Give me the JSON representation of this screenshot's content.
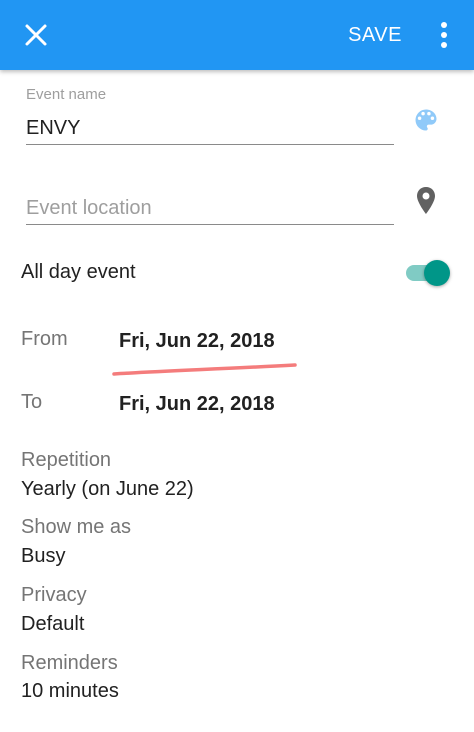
{
  "appbar": {
    "save_label": "SAVE",
    "color": "#2196F3",
    "icons": [
      "close-icon",
      "more-vert-icon"
    ]
  },
  "event": {
    "name_label": "Event name",
    "name_value": "ENVY",
    "location_placeholder": "Event location",
    "location_value": "",
    "icons": [
      "palette-icon",
      "location-pin-icon"
    ]
  },
  "all_day": {
    "label": "All day event",
    "on": true,
    "color": "#009688"
  },
  "from": {
    "label": "From",
    "value": "Fri, Jun 22, 2018"
  },
  "to": {
    "label": "To",
    "value": "Fri, Jun 22, 2018"
  },
  "annotation": {
    "type": "hand-drawn underline",
    "color": "#F47C7C"
  },
  "details": {
    "repetition": {
      "label": "Repetition",
      "value": "Yearly (on June 22)"
    },
    "show_as": {
      "label": "Show me as",
      "value": "Busy"
    },
    "privacy": {
      "label": "Privacy",
      "value": "Default"
    },
    "reminders": {
      "label": "Reminders",
      "value": "10 minutes"
    }
  }
}
